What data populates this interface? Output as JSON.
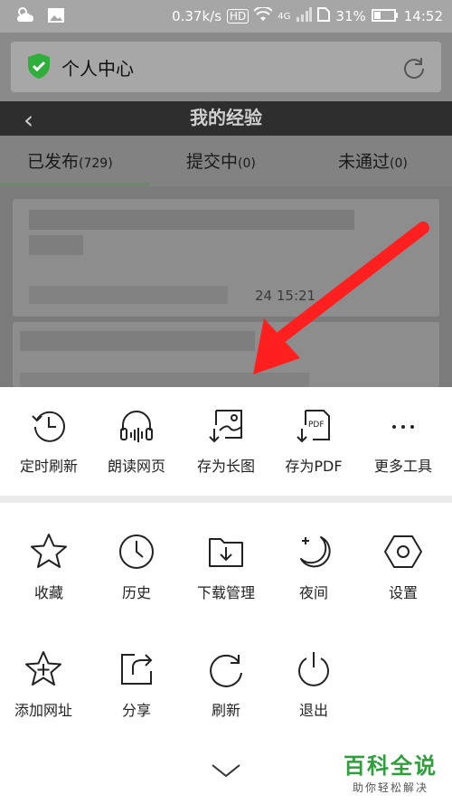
{
  "status_bar": {
    "speed": "0.37k/s",
    "hd": "HD",
    "network": "4G",
    "battery": "31%",
    "time": "14:52"
  },
  "address_bar": {
    "title": "个人中心"
  },
  "page": {
    "title": "我的经验",
    "back_glyph": "‹"
  },
  "tabs": [
    {
      "label": "已发布",
      "count": "(729)"
    },
    {
      "label": "提交中",
      "count": "(0)"
    },
    {
      "label": "未通过",
      "count": "(0)"
    }
  ],
  "content": {
    "timestamp": "24 15:21"
  },
  "menu": {
    "top_row": [
      {
        "label": "定时刷新",
        "icon": "timer-refresh-icon"
      },
      {
        "label": "朗读网页",
        "icon": "headphones-icon"
      },
      {
        "label": "存为长图",
        "icon": "save-image-icon"
      },
      {
        "label": "存为PDF",
        "icon": "save-pdf-icon",
        "badge": "PDF"
      },
      {
        "label": "更多工具",
        "icon": "more-icon"
      }
    ],
    "middle_row": [
      {
        "label": "收藏",
        "icon": "star-icon"
      },
      {
        "label": "历史",
        "icon": "clock-icon"
      },
      {
        "label": "下载管理",
        "icon": "download-icon"
      },
      {
        "label": "夜间",
        "icon": "moon-icon"
      },
      {
        "label": "设置",
        "icon": "settings-icon"
      }
    ],
    "bottom_row": [
      {
        "label": "添加网址",
        "icon": "add-star-icon"
      },
      {
        "label": "分享",
        "icon": "share-icon"
      },
      {
        "label": "刷新",
        "icon": "refresh-icon"
      },
      {
        "label": "退出",
        "icon": "power-icon"
      }
    ]
  },
  "watermark": {
    "line1": "百科全说",
    "line2": "助你轻松解决"
  },
  "colors": {
    "accent_arrow": "#ff1f1f",
    "watermark_green": "#2e9f3a",
    "shield_green": "#2fae3c"
  }
}
